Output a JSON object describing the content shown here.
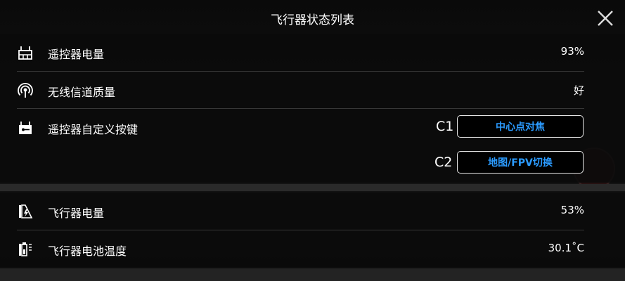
{
  "title": "飞行器状态列表",
  "rc_battery": {
    "label": "遥控器电量",
    "value": "93%"
  },
  "signal": {
    "label": "无线信道质量",
    "value": "好"
  },
  "custom_keys": {
    "label": "遥控器自定义按键",
    "c1": {
      "key": "C1",
      "action": "中心点对焦"
    },
    "c2": {
      "key": "C2",
      "action": "地图/FPV切换"
    }
  },
  "aircraft_battery": {
    "label": "飞行器电量",
    "value": "53%"
  },
  "battery_temp": {
    "label": "飞行器电池温度",
    "value": "30.1˚C"
  },
  "colors": {
    "accent": "#2b9bff",
    "background": "#000000"
  }
}
